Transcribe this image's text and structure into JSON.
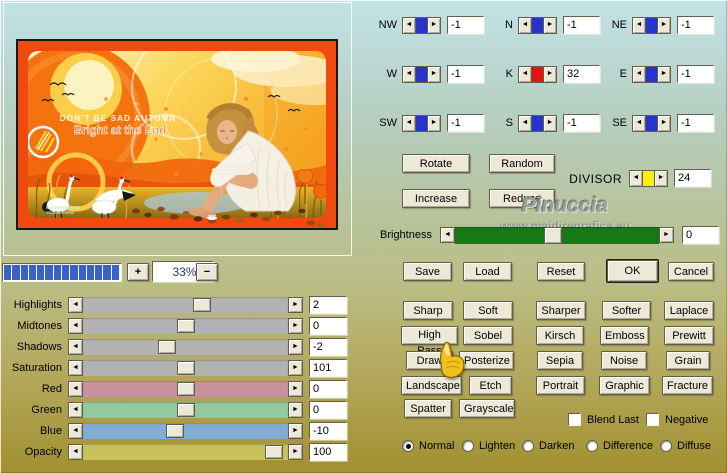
{
  "icons": {
    "left_arrow": "◄",
    "right_arrow": "►"
  },
  "artwork": {
    "caption_upper": "DON'T BE SAD AUTUMN",
    "caption_lower": "Bright at the End"
  },
  "zoom_control": {
    "plus": "+",
    "value": "33%",
    "minus": "−"
  },
  "adjustments": [
    {
      "label": "Highlights",
      "value": "2",
      "thumb": "58%",
      "track": "#b2b2b2"
    },
    {
      "label": "Midtones",
      "value": "0",
      "thumb": "50%",
      "track": "#b2b2b2"
    },
    {
      "label": "Shadows",
      "value": "-2",
      "thumb": "41%",
      "track": "#b2b2b2"
    },
    {
      "label": "Saturation",
      "value": "101",
      "thumb": "50%",
      "track": "#b2b2b2"
    },
    {
      "label": "Red",
      "value": "0",
      "thumb": "50%",
      "track": "#c9919e"
    },
    {
      "label": "Green",
      "value": "0",
      "thumb": "50%",
      "track": "#92c8a3"
    },
    {
      "label": "Blue",
      "value": "-10",
      "thumb": "45%",
      "track": "#84abd5"
    },
    {
      "label": "Opacity",
      "value": "100",
      "thumb": "93%",
      "track": "#c9c15c"
    }
  ],
  "kernel": [
    {
      "label": "NW",
      "value": "-1",
      "bar": "#2633cc"
    },
    {
      "label": "N",
      "value": "-1",
      "bar": "#2633cc"
    },
    {
      "label": "NE",
      "value": "-1",
      "bar": "#2633cc"
    },
    {
      "label": "W",
      "value": "-1",
      "bar": "#2633cc"
    },
    {
      "label": "K",
      "value": "32",
      "bar": "#e81111"
    },
    {
      "label": "E",
      "value": "-1",
      "bar": "#2633cc"
    },
    {
      "label": "SW",
      "value": "-1",
      "bar": "#2633cc"
    },
    {
      "label": "S",
      "value": "-1",
      "bar": "#2633cc"
    },
    {
      "label": "SE",
      "value": "-1",
      "bar": "#2633cc"
    }
  ],
  "divisor": {
    "label": "DIVISOR",
    "value": "24",
    "bar": "#f7ee12"
  },
  "transform": {
    "rotate": "Rotate",
    "random": "Random",
    "increase": "Increase",
    "reduce": "Reduce"
  },
  "watermark": {
    "name": "Pinuccia",
    "site": "www.maidiregrafica.eu"
  },
  "brightness": {
    "label": "Brightness",
    "value": "0",
    "thumb": "48%"
  },
  "actions": {
    "save": "Save",
    "load": "Load",
    "reset": "Reset",
    "ok": "OK",
    "cancel": "Cancel"
  },
  "filters": [
    "Sharp",
    "Soft",
    "Sharper",
    "Softer",
    "Laplace",
    "High Pass",
    "Sobel",
    "Kirsch",
    "Emboss",
    "Prewitt",
    "Draw",
    "Posterize",
    "Sepia",
    "Noise",
    "Grain",
    "Landscape",
    "Etch",
    "Portrait",
    "Graphic",
    "Fracture",
    "Spatter",
    "Grayscale"
  ],
  "options": [
    {
      "label": "Blend Last",
      "checked": false
    },
    {
      "label": "Negative",
      "checked": false
    }
  ],
  "blend_modes": [
    {
      "label": "Normal",
      "selected": true
    },
    {
      "label": "Lighten",
      "selected": false
    },
    {
      "label": "Darken",
      "selected": false
    },
    {
      "label": "Difference",
      "selected": false
    },
    {
      "label": "Diffuse",
      "selected": false
    }
  ]
}
